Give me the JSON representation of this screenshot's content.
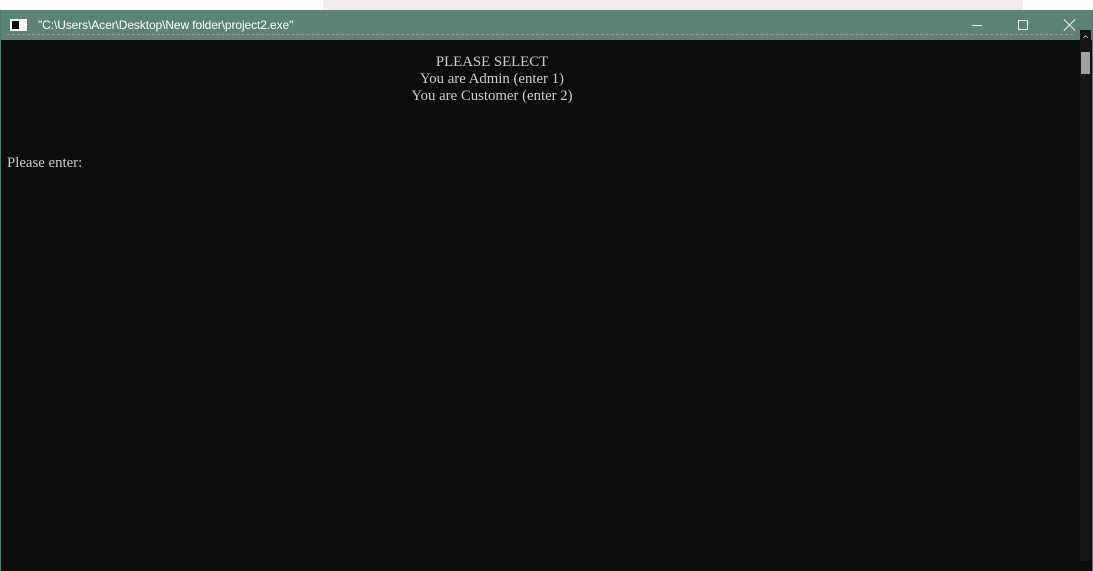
{
  "window": {
    "title": "\"C:\\Users\\Acer\\Desktop\\New folder\\project2.exe\"",
    "accent_color": "#5b8377",
    "icons": {
      "app": "console-app-icon",
      "minimize": "minimize-icon",
      "maximize": "maximize-icon",
      "close": "close-icon",
      "scroll_up": "chevron-up-icon"
    }
  },
  "console": {
    "background": "#0c0c0c",
    "text_color": "#cccccc",
    "menu": {
      "title": "PLEASE SELECT",
      "options": [
        "You are Admin (enter 1)",
        "You are Customer (enter 2)"
      ]
    },
    "prompt": "Please enter:"
  },
  "scrollbar": {
    "up_arrow": "^"
  }
}
